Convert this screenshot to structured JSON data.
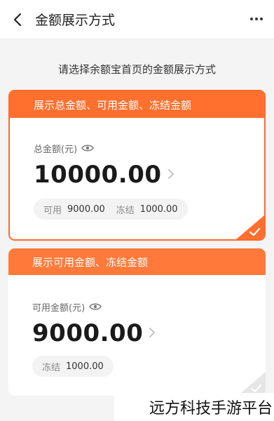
{
  "header": {
    "title": "金额展示方式",
    "back_icon": "chevron-left-icon",
    "more_icon": "more-icon"
  },
  "subtitle": "请选择余额宝首页的金额展示方式",
  "options": [
    {
      "title": "展示总金额、可用金额、冻结金额",
      "label": "总金额(元)",
      "amount": "10000.00",
      "available_label": "可用",
      "available_value": "9000.00",
      "frozen_label": "冻结",
      "frozen_value": "1000.00",
      "selected": true
    },
    {
      "title": "展示可用金额、冻结金额",
      "label": "可用金额(元)",
      "amount": "9000.00",
      "frozen_label": "冻结",
      "frozen_value": "1000.00",
      "selected": false
    }
  ],
  "watermark": "远方科技手游平台",
  "colors": {
    "accent": "#ff6f2e",
    "header_bg": "#ff7a3a"
  }
}
